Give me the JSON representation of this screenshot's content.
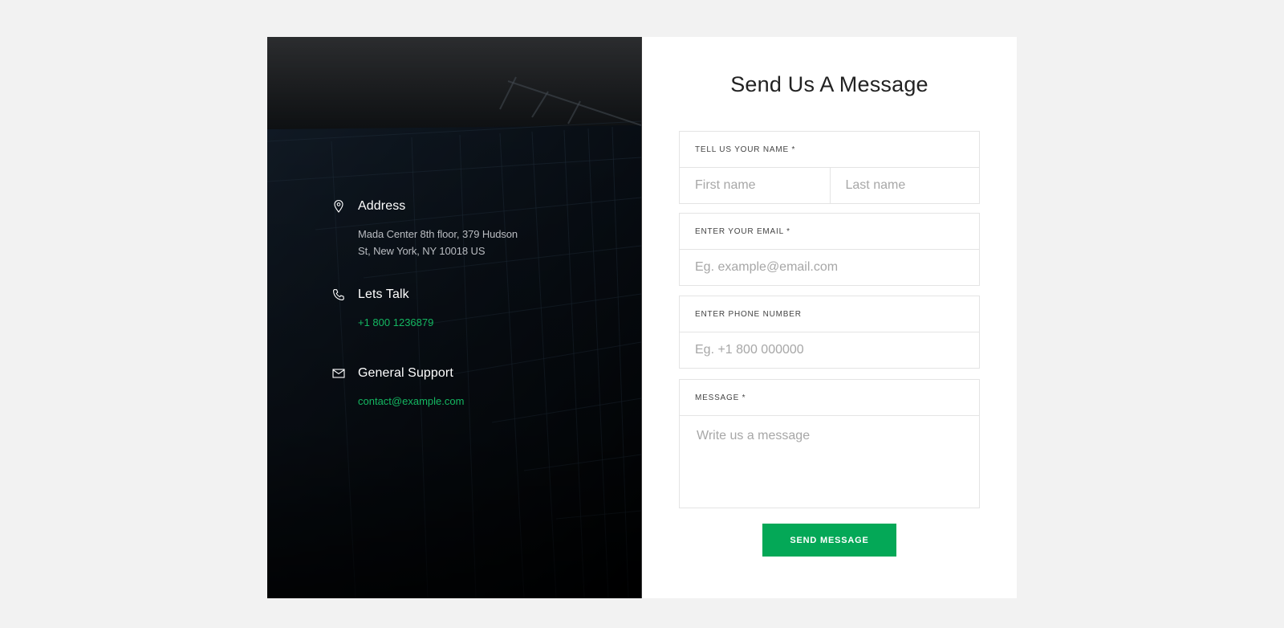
{
  "contact_info": {
    "address": {
      "icon": "map-pin-icon",
      "title": "Address",
      "line1": "Mada Center 8th floor, 379 Hudson",
      "line2": "St, New York, NY 10018 US"
    },
    "talk": {
      "icon": "phone-icon",
      "title": "Lets Talk",
      "phone": "+1 800 1236879"
    },
    "support": {
      "icon": "mail-icon",
      "title": "General Support",
      "email": "contact@example.com"
    }
  },
  "form": {
    "title": "Send Us A Message",
    "name": {
      "label": "TELL US YOUR NAME *",
      "first_placeholder": "First name",
      "last_placeholder": "Last name"
    },
    "email": {
      "label": "ENTER YOUR EMAIL *",
      "placeholder": "Eg. example@email.com"
    },
    "phone": {
      "label": "ENTER PHONE NUMBER",
      "placeholder": "Eg. +1 800 000000"
    },
    "message": {
      "label": "MESSAGE *",
      "placeholder": "Write us a message"
    },
    "submit_label": "SEND MESSAGE"
  },
  "colors": {
    "accent": "#04a857",
    "link": "#14b761",
    "page_bg": "#f2f2f2"
  }
}
